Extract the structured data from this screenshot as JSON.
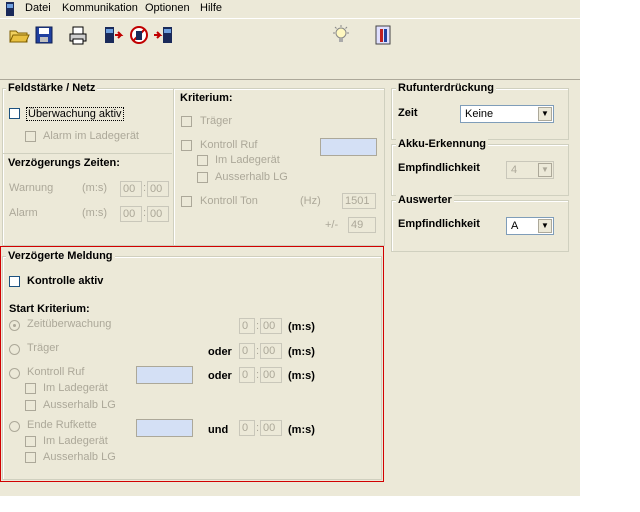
{
  "menu": [
    "Datei",
    "Kommunikation",
    "Optionen",
    "Hilfe"
  ],
  "toolbar_icons": [
    "open-folder-icon",
    "save-icon",
    "print-icon",
    "connect-icon",
    "stop-icon",
    "disconnect-icon",
    "lightbulb-icon",
    "info-icon"
  ],
  "feldstaerke": {
    "title": "Feldstärke / Netz",
    "ueberwachung": "Überwachung aktiv",
    "alarm_ladegeraet": "Alarm im Ladegerät",
    "verzoegerung_title": "Verzögerungs Zeiten:",
    "warnung": "Warnung",
    "alarm": "Alarm",
    "unit": "(m:s)",
    "mm": "00",
    "ss": "00"
  },
  "kriterium": {
    "title": "Kriterium:",
    "traeger": "Träger",
    "kontroll_ruf": "Kontroll Ruf",
    "im_ladegeraet": "Im Ladegerät",
    "ausserhalb_lg": "Ausserhalb LG",
    "kontroll_ton": "Kontroll Ton",
    "hz": "(Hz)",
    "hz_value": "1501",
    "plusminus": "+/-",
    "tolerance": "49"
  },
  "rufunterdrueckung": {
    "title": "Rufunterdrückung",
    "label": "Zeit",
    "value": "Keine"
  },
  "akku": {
    "title": "Akku-Erkennung",
    "label": "Empfindlichkeit",
    "value": "4"
  },
  "auswerter": {
    "title": "Auswerter",
    "label": "Empfindlichkeit",
    "value": "A"
  },
  "verzoegerte": {
    "title": "Verzögerte Meldung",
    "kontrolle": "Kontrolle aktiv",
    "start": "Start Kriterium:",
    "zeit": "Zeitüberwachung",
    "traeger": "Träger",
    "kontroll_ruf": "Kontroll Ruf",
    "im_ladegeraet": "Im Ladegerät",
    "ausserhalb_lg": "Ausserhalb LG",
    "ende_rufkette": "Ende Rufkette",
    "oder": "oder",
    "und": "und",
    "unit": "(m:s)",
    "min": "0",
    "sec": "00"
  }
}
